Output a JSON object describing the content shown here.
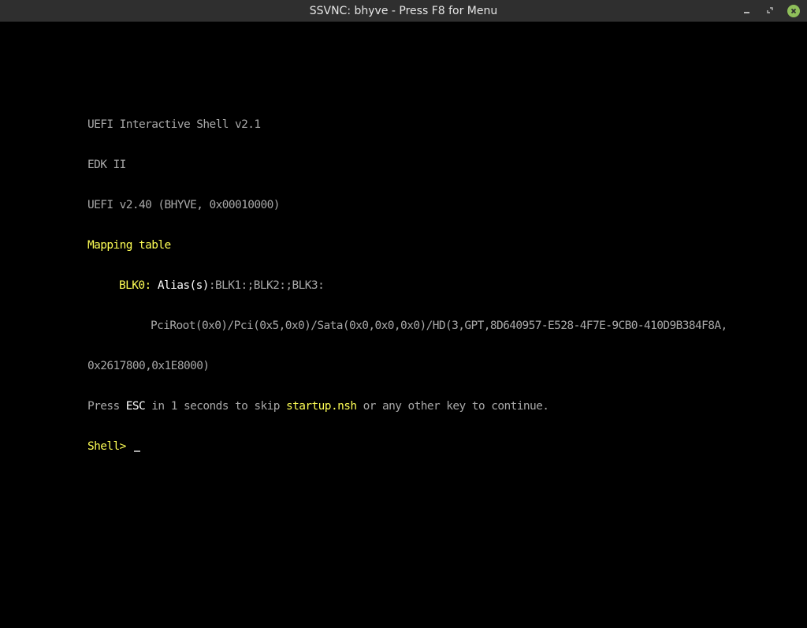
{
  "window": {
    "title": "SSVNC: bhyve - Press F8 for Menu",
    "controls": {
      "minimize_icon": "minimize-icon",
      "maximize_icon": "maximize-icon",
      "close_icon": "close-icon",
      "close_color": "#8fbf5a"
    }
  },
  "console": {
    "colors": {
      "default": "#a8a8a8",
      "highlight": "#ffff55",
      "bright": "#ffffff",
      "background": "#000000"
    },
    "line1": "UEFI Interactive Shell v2.1",
    "line2": "EDK II",
    "line3": "UEFI v2.40 (BHYVE, 0x00010000)",
    "line4": "Mapping table",
    "blk_name": "BLK0",
    "blk_colon": ":",
    "alias_label": "Alias(s)",
    "alias_values": ":BLK1:;BLK2:;BLK3:",
    "device_path": "PciRoot(0x0)/Pci(0x5,0x0)/Sata(0x0,0x0,0x0)/HD(3,GPT,8D640957-E528-4F7E-9CB0-410D9B384F8A,",
    "device_path_cont": "0x2617800,0x1E8000)",
    "press_prefix": "Press ",
    "press_key": "ESC",
    "press_middle": " in 1 seconds to skip ",
    "press_script": "startup.nsh",
    "press_suffix": " or any other key to continue.",
    "prompt": "Shell> "
  }
}
